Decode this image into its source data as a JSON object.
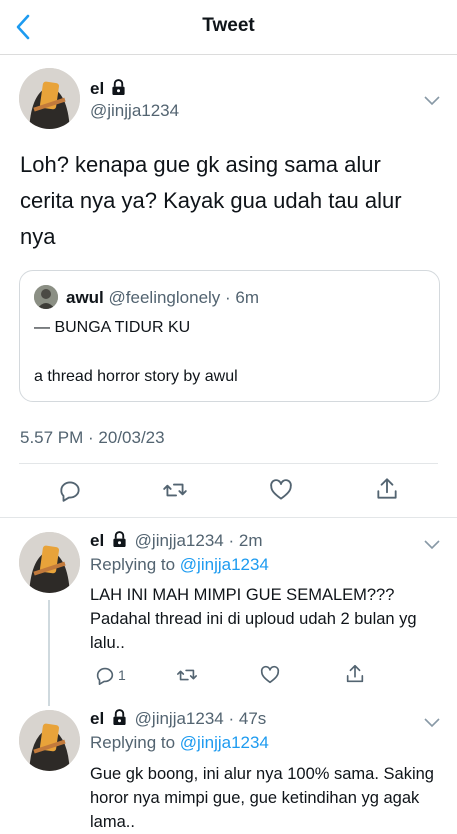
{
  "header": {
    "title": "Tweet"
  },
  "tweet": {
    "author_name": "el",
    "author_handle": "@jinjja1234",
    "text": "Loh? kenapa gue gk asing sama alur cerita nya ya? Kayak gua udah tau alur nya",
    "quote": {
      "name": "awul",
      "handle": "@feelinglonely",
      "time": "6m",
      "line1": "— BUNGA TIDUR KU",
      "line2": "a thread horror story by awul"
    },
    "timestamp": "5.57 PM · 20/03/23"
  },
  "replies": [
    {
      "name": "el",
      "handle": "@jinjja1234",
      "time": "2m",
      "replying_prefix": "Replying to",
      "replying_to": "@jinjja1234",
      "text": "LAH INI MAH MIMPI GUE SEMALEM??? Padahal thread ini di uploud udah 2 bulan yg lalu..",
      "reply_count": "1"
    },
    {
      "name": "el",
      "handle": "@jinjja1234",
      "time": "47s",
      "replying_prefix": "Replying to",
      "replying_to": "@jinjja1234",
      "text": "Gue gk boong, ini alur nya 100% sama. Saking horor nya mimpi gue, gue ketindihan yg agak lama.."
    }
  ],
  "colors": {
    "link": "#1d9bf0",
    "secondary": "#536471"
  },
  "icons": [
    "back-chevron-icon",
    "lock-icon",
    "chevron-down-icon",
    "reply-icon",
    "retweet-icon",
    "like-icon",
    "share-icon"
  ]
}
